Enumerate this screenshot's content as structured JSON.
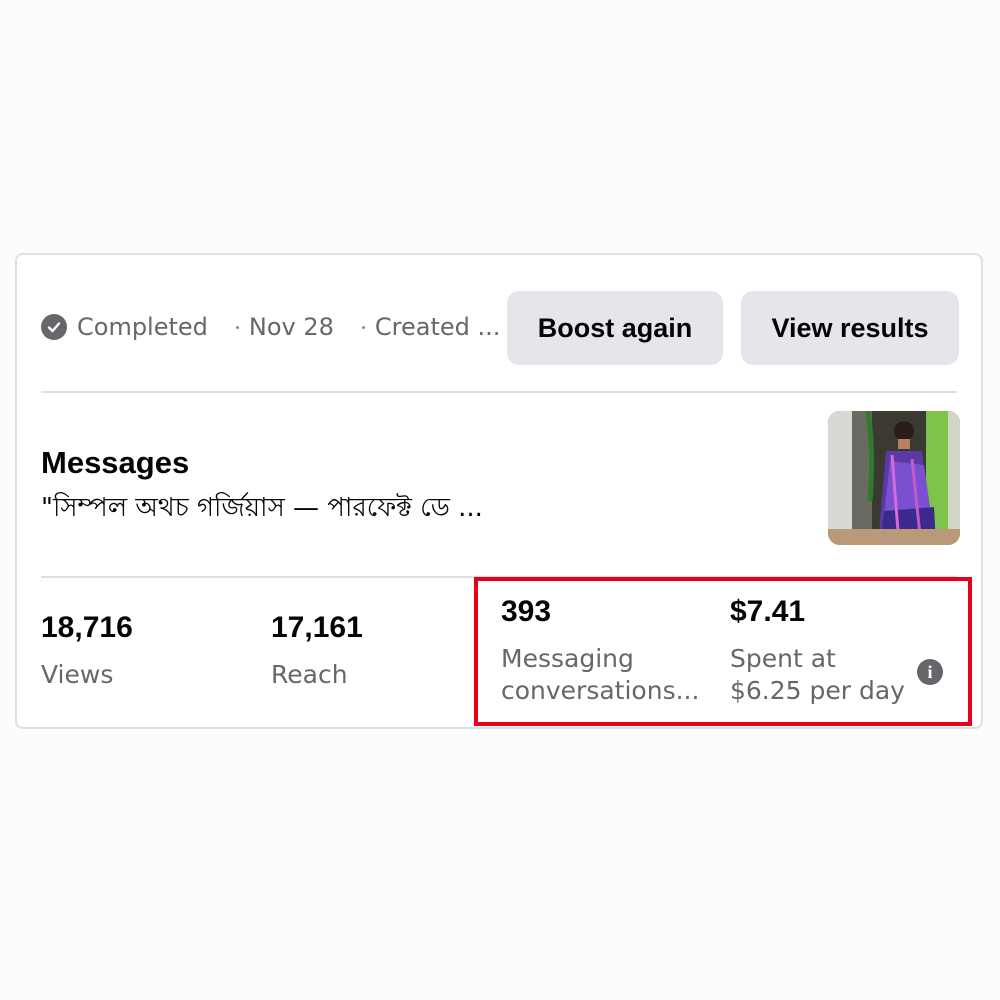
{
  "header": {
    "status": "Completed",
    "date": "Nov 28",
    "created": "Created ...",
    "boost_again_label": "Boost again",
    "view_results_label": "View results"
  },
  "ad": {
    "title": "Messages",
    "subtitle": "\"সিম্পল অথচ গর্জিয়াস — পারফেক্ট ডে ..."
  },
  "stats": [
    {
      "value": "18,716",
      "label": "Views"
    },
    {
      "value": "17,161",
      "label": "Reach"
    },
    {
      "value": "393",
      "label": "Messaging conversations..."
    },
    {
      "value": "$7.41",
      "label": "Spent at $6.25 per day"
    }
  ],
  "colors": {
    "highlight": "#e8001a",
    "button_bg": "#e4e6eb",
    "muted_text": "#65676b"
  },
  "icons": [
    "check-circle-icon",
    "info-icon"
  ]
}
